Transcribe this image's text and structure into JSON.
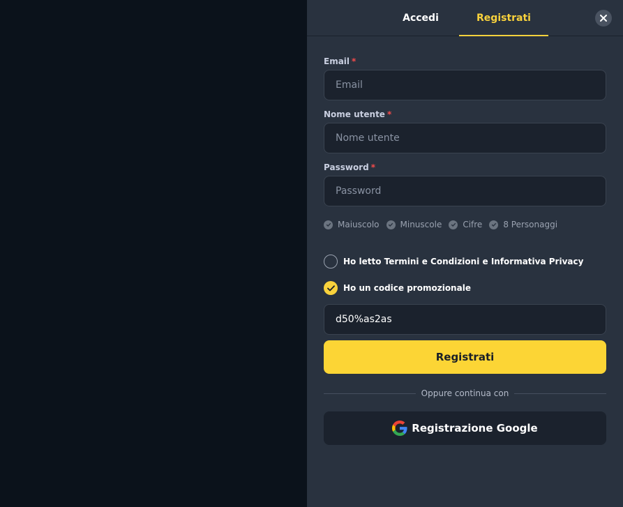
{
  "tabs": {
    "login_label": "Accedi",
    "register_label": "Registrati"
  },
  "form": {
    "email_label": "Email",
    "email_placeholder": "Email",
    "username_label": "Nome utente",
    "username_placeholder": "Nome utente",
    "password_label": "Password",
    "password_placeholder": "Password",
    "required_mark": "*",
    "password_rules": [
      "Maiuscolo",
      "Minuscole",
      "Cifre",
      "8 Personaggi"
    ],
    "terms_label": "Ho letto Termini e Condizioni e Informativa Privacy",
    "terms_checked": false,
    "promo_label": "Ho un codice promozionale",
    "promo_checked": true,
    "promo_value": "d50%as2as",
    "submit_label": "Registrati",
    "divider_text": "Oppure continua con",
    "google_label": "Registrazione Google"
  },
  "colors": {
    "accent": "#fcd535",
    "panel_bg": "#29323f",
    "backdrop": "#0b121b",
    "input_bg": "#1b222d",
    "required": "#f44b4b"
  }
}
